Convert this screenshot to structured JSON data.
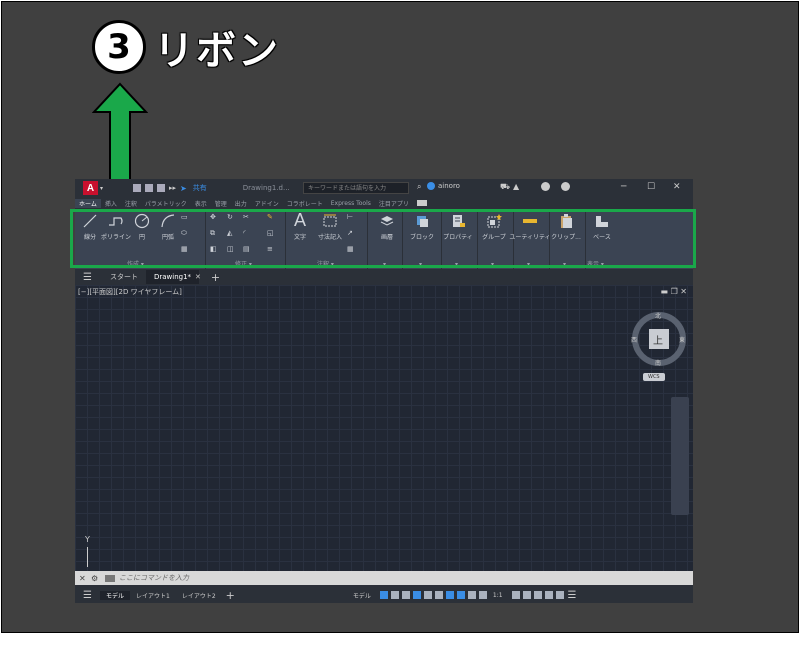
{
  "callout": {
    "number": "3",
    "text": "リボン"
  },
  "colors": {
    "highlight_box": "#1aa84a",
    "arrow": "#1aa84a",
    "accent": "#3a8ee6",
    "logo": "#c8102e"
  },
  "titlebar": {
    "logo": "A",
    "share": "共有",
    "document": "Drawing1.d...",
    "search_placeholder": "キーワードまたは語句を入力",
    "user": "ainoro",
    "minimize": "─",
    "maximize": "☐",
    "close": "✕"
  },
  "ribbon_tabs": [
    "ホーム",
    "挿入",
    "注釈",
    "パラメトリック",
    "表示",
    "管理",
    "出力",
    "アドイン",
    "コラボレート",
    "Express Tools",
    "注目アプリ"
  ],
  "ribbon": {
    "draw": {
      "line": "線分",
      "polyline": "ポリライン",
      "circle": "円",
      "arc": "円弧",
      "panel": "作成 ▾"
    },
    "modify": {
      "panel": "修正 ▾"
    },
    "annotation": {
      "text": "文字",
      "dimension": "寸法記入",
      "panel": "注釈 ▾"
    },
    "layers": {
      "label": "画層"
    },
    "block": {
      "label": "ブロック"
    },
    "properties": {
      "label": "プロパティ"
    },
    "groups": {
      "label": "グループ"
    },
    "utilities": {
      "label": "ユーティリティ"
    },
    "clipboard": {
      "label": "クリップ..."
    },
    "view": {
      "label": "ベース",
      "panel": "表示 ▾"
    }
  },
  "file_tabs": [
    "スタート",
    "Drawing1*"
  ],
  "viewport": {
    "label": "[−][平面図][2D ワイヤフレーム]",
    "viewcube": {
      "top": "上",
      "north": "北",
      "south": "南",
      "east": "東",
      "west": "西",
      "wcs": "WCS"
    },
    "y_axis": "Y"
  },
  "command": {
    "placeholder": "ここにコマンドを入力"
  },
  "status_tabs": [
    "モデル",
    "レイアウト1",
    "レイアウト2"
  ],
  "status": {
    "model": "モデル",
    "scale": "1:1"
  }
}
